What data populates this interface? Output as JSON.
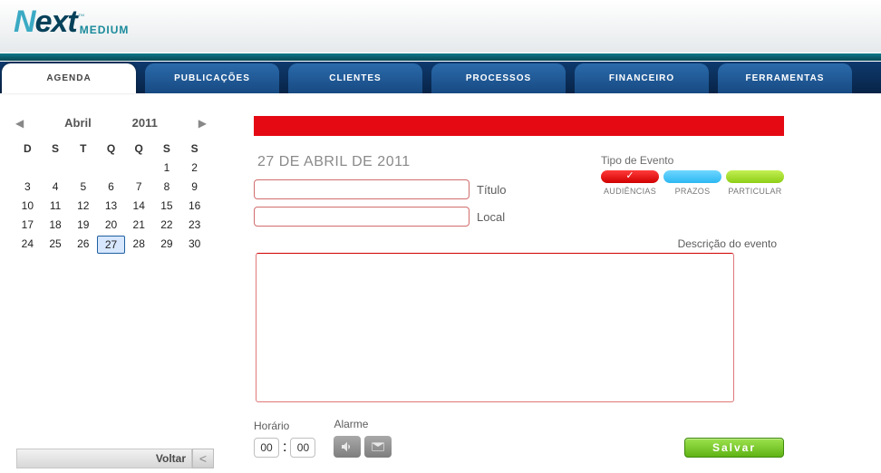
{
  "logo": {
    "main": "Next",
    "ext": "MEDIUM"
  },
  "nav": {
    "tabs": [
      {
        "label": "AGENDA",
        "active": true
      },
      {
        "label": "PUBLICAÇÕES",
        "active": false
      },
      {
        "label": "CLIENTES",
        "active": false
      },
      {
        "label": "PROCESSOS",
        "active": false
      },
      {
        "label": "FINANCEIRO",
        "active": false
      },
      {
        "label": "FERRAMENTAS",
        "active": false
      }
    ]
  },
  "calendar": {
    "month": "Abril",
    "year": "2011",
    "dow": [
      "D",
      "S",
      "T",
      "Q",
      "Q",
      "S",
      "S"
    ],
    "blanks": 5,
    "days": 30,
    "selected": 27
  },
  "back": {
    "label": "Voltar"
  },
  "event": {
    "date_title": "27 DE ABRIL DE 2011",
    "title_field": {
      "label": "Título",
      "value": ""
    },
    "local_field": {
      "label": "Local",
      "value": ""
    },
    "type_header": "Tipo de Evento",
    "types": [
      {
        "key": "aud",
        "label": "AUDIÊNCIAS",
        "color": "red",
        "selected": true
      },
      {
        "key": "prz",
        "label": "PRAZOS",
        "color": "blue",
        "selected": false
      },
      {
        "key": "par",
        "label": "PARTICULAR",
        "color": "green",
        "selected": false
      }
    ],
    "desc_label": "Descrição do evento",
    "desc_value": "",
    "time_label": "Horário",
    "time_h": "00",
    "time_m": "00",
    "alarm_label": "Alarme",
    "save_label": "Salvar"
  }
}
